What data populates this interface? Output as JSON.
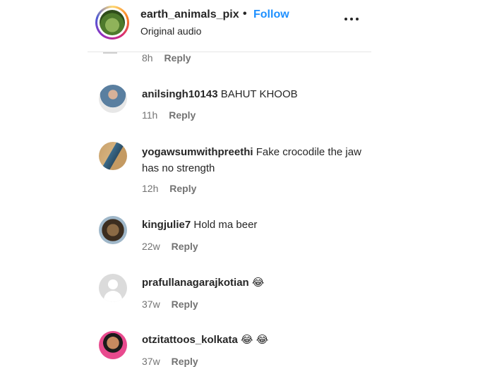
{
  "header": {
    "username": "earth_animals_pix",
    "separator": "•",
    "follow_label": "Follow",
    "subtitle": "Original audio",
    "more_icon": "more-horizontal-icon"
  },
  "fragment": {
    "time": "8h",
    "reply": "Reply"
  },
  "comments": [
    {
      "user": "anilsingh10143",
      "text": "BAHUT KHOOB",
      "time": "11h",
      "reply": "Reply"
    },
    {
      "user": "yogawsumwithpreethi",
      "text": "Fake crocodile the jaw has no strength",
      "time": "12h",
      "reply": "Reply"
    },
    {
      "user": "kingjulie7",
      "text": "Hold ma beer",
      "time": "22w",
      "reply": "Reply"
    },
    {
      "user": "prafullanagarajkotian",
      "text": "😂",
      "time": "37w",
      "reply": "Reply"
    },
    {
      "user": "otzitattoos_kolkata",
      "text": "😂 😂",
      "time": "37w",
      "reply": "Reply"
    }
  ]
}
